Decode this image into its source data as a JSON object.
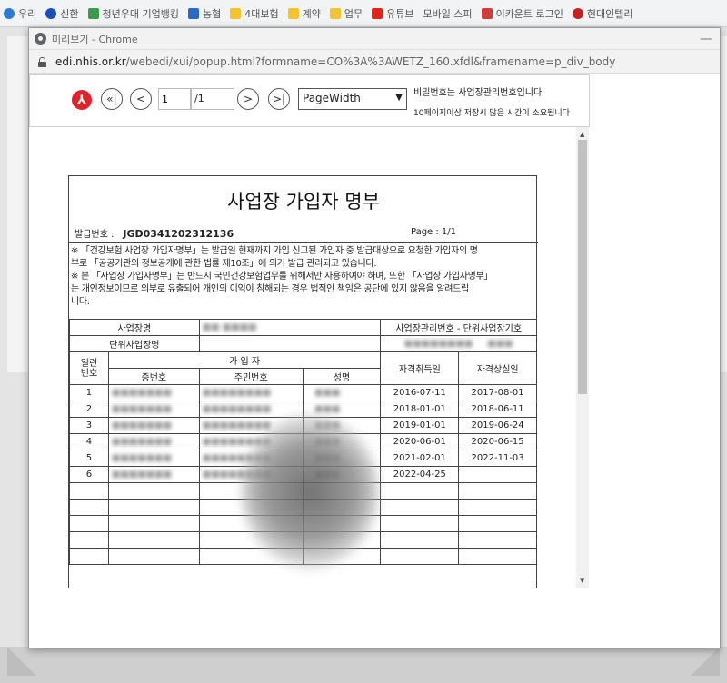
{
  "bookmarks": [
    "우리",
    "신한",
    "청년우대 기업뱅킹",
    "농협",
    "4대보험",
    "계약",
    "업무",
    "유튜브",
    "모바일 스피",
    "이카운트 로그인",
    "현대인텔리"
  ],
  "window": {
    "title": "미리보기 - Chrome",
    "url_domain": "edi.nhis.or.kr",
    "url_path": "/webedi/xui/popup.html?formname=CO%3A%3AWETZ_160.xfdl&framename=p_div_body"
  },
  "toolbar": {
    "first_icon": "«|",
    "prev_icon": "<",
    "next_icon": ">",
    "last_icon": ">|",
    "page_current": "1",
    "page_total": "/1",
    "zoom_value": "PageWidth",
    "password_notice": "비밀번호는 사업장관리번호입니다",
    "save_notice": "10페이지이상 저장시 많은 시간이 소요됩니다"
  },
  "document": {
    "title": "사업장 가입자 명부",
    "issue_label": "발급번호 :",
    "issue_number": "JGD0341202312136",
    "page_info": "Page : 1/1",
    "notes": [
      "※ 「건강보험 사업장 가입자명부」는 발급일 현재까지 가입 신고된 가입자 중 발급대상으로 요청한 가입자의 명",
      "부로 「공공기관의 정보공개에 관한 법률 제10조」에 의거 발급 관리되고 있습니다.",
      "※ 본 「사업장 가입자명부」는 반드시 국민건강보험업무를 위해서만 사용하여야 하며, 또한 「사업장 가입자명부」",
      "는 개인정보이므로 외부로 유출되어 개인의 이익이 침해되는 경우 법적인 책임은 공단에 있지 않음을 알려드립",
      "니다."
    ],
    "labels": {
      "business_name": "사업장명",
      "business_mgmt_no": "사업장관리번호 - 단위사업장기호",
      "unit_business_name": "단위사업장명",
      "serial": "일련번호",
      "subscriber": "가 입 자",
      "cert_no": "증번호",
      "resident_no": "주민번호",
      "name": "성명",
      "acquired_date": "자격취득일",
      "lost_date": "자격상실일"
    },
    "rows": [
      {
        "no": "1",
        "acquired": "2016-07-11",
        "lost": "2017-08-01"
      },
      {
        "no": "2",
        "acquired": "2018-01-01",
        "lost": "2018-06-11"
      },
      {
        "no": "3",
        "acquired": "2019-01-01",
        "lost": "2019-06-24"
      },
      {
        "no": "4",
        "acquired": "2020-06-01",
        "lost": "2020-06-15"
      },
      {
        "no": "5",
        "acquired": "2021-02-01",
        "lost": "2022-11-03"
      },
      {
        "no": "6",
        "acquired": "2022-04-25",
        "lost": ""
      }
    ]
  }
}
